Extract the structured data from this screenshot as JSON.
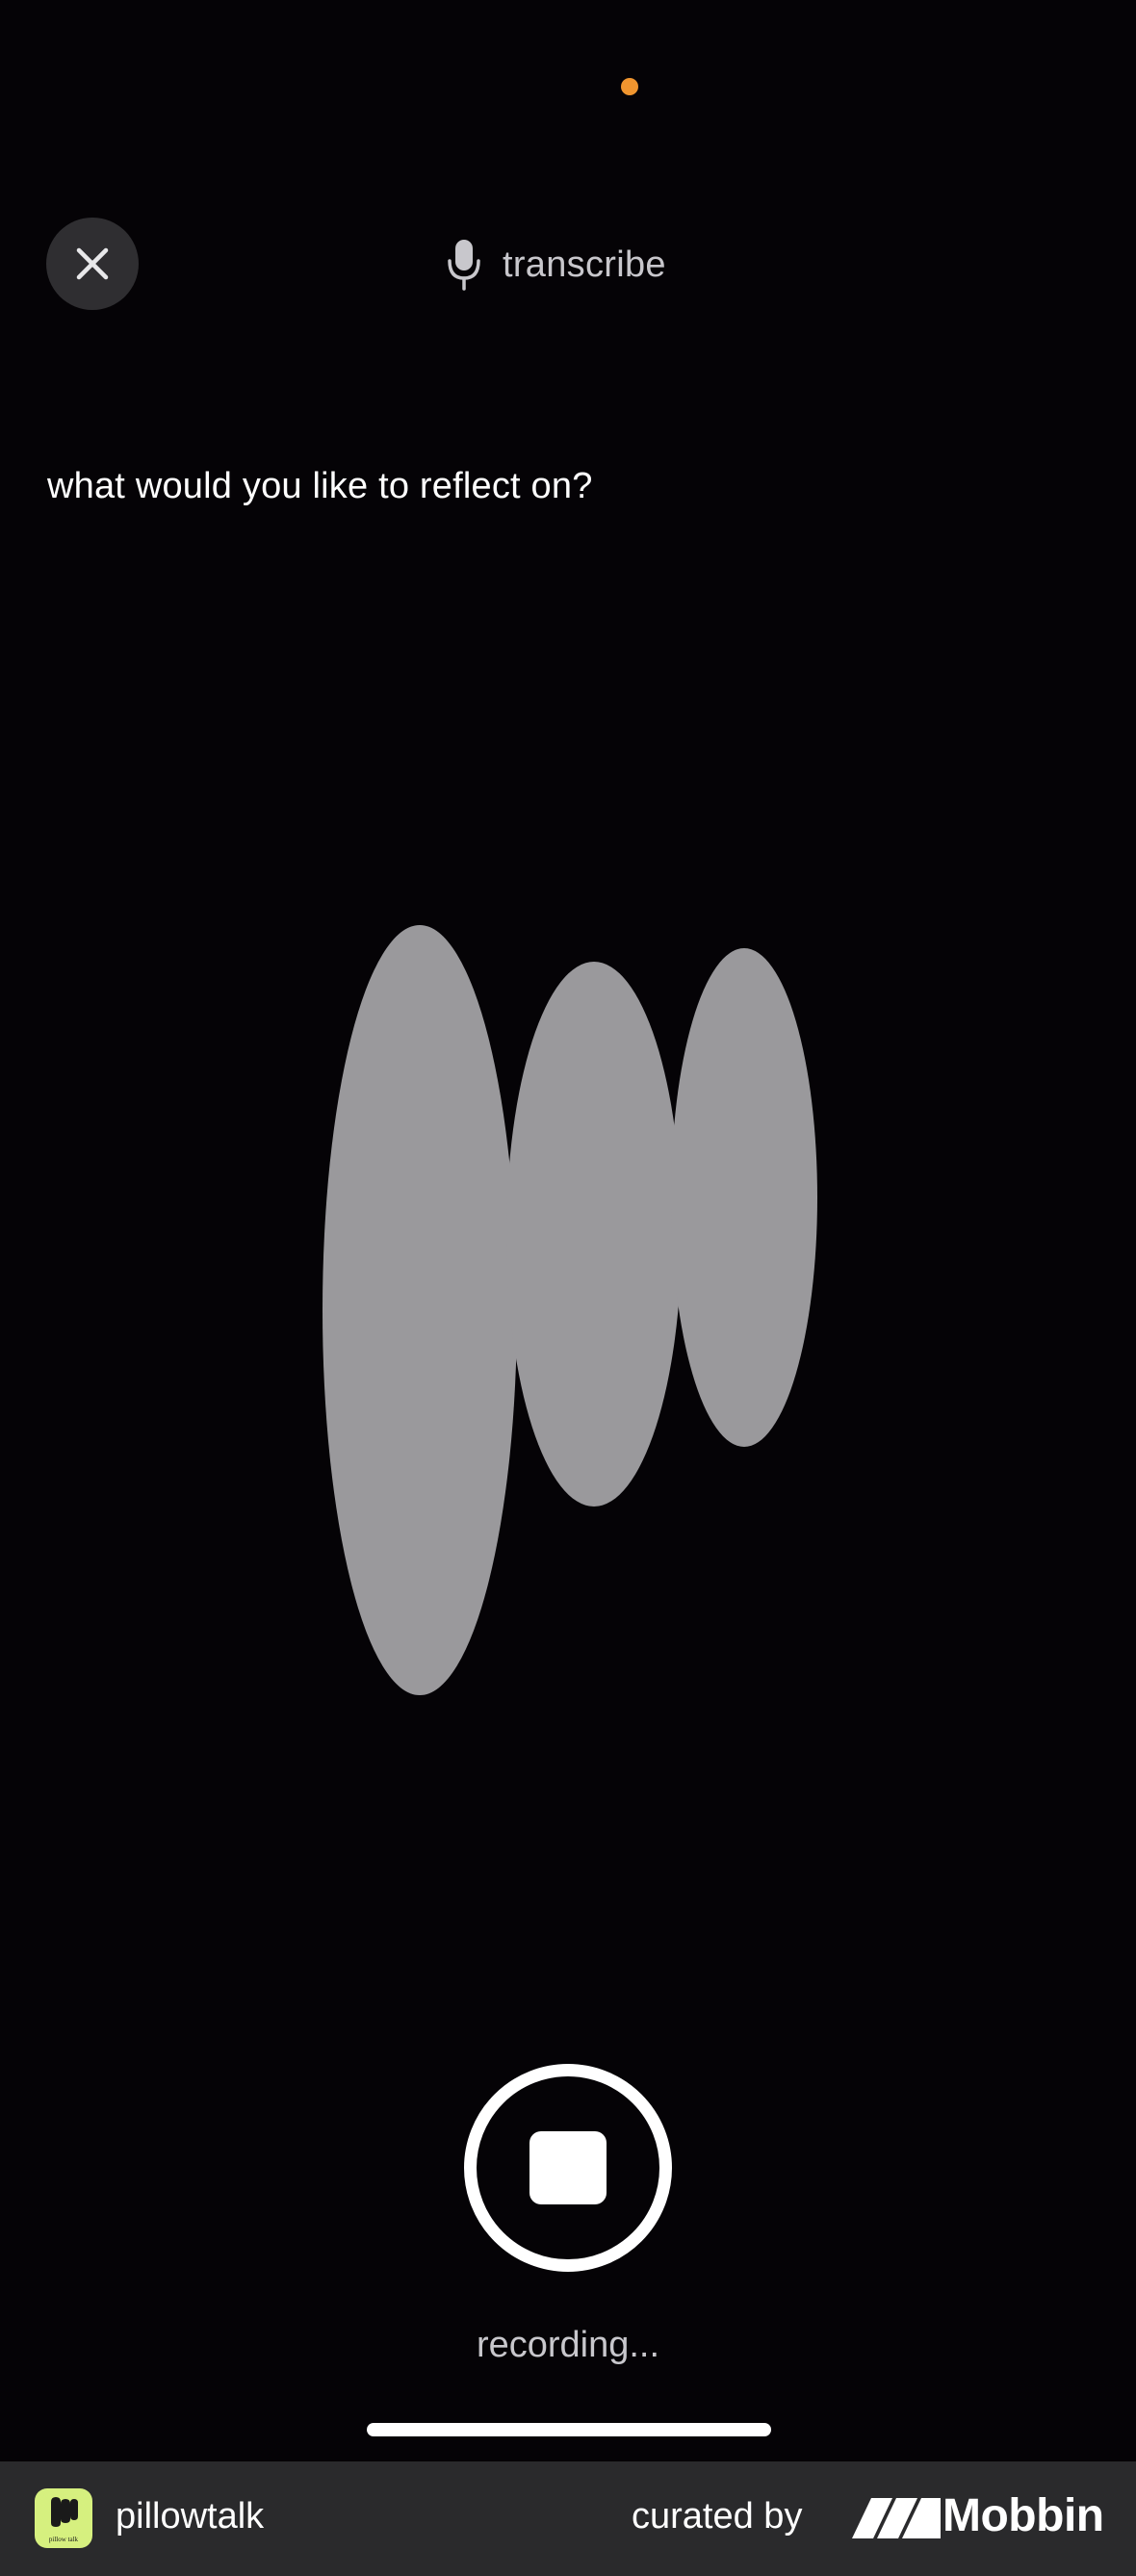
{
  "header": {
    "close_icon": "close-icon",
    "transcribe_icon": "microphone-icon",
    "transcribe_label": "transcribe"
  },
  "main": {
    "prompt": "what would you like to reflect on?",
    "visualizer": {
      "description_icon": "voice-waveform",
      "color": "#9a999c"
    }
  },
  "controls": {
    "stop_icon": "stop-icon",
    "status": "recording..."
  },
  "footer": {
    "app_name": "pillowtalk",
    "app_logo_text": "pillow talk",
    "curated_by": "curated by",
    "brand": "Mobbin"
  },
  "colors": {
    "background": "#050306",
    "status_dot": "#f0952f",
    "footer": "#2a2a2c",
    "app_logo": "#d6f07f"
  }
}
